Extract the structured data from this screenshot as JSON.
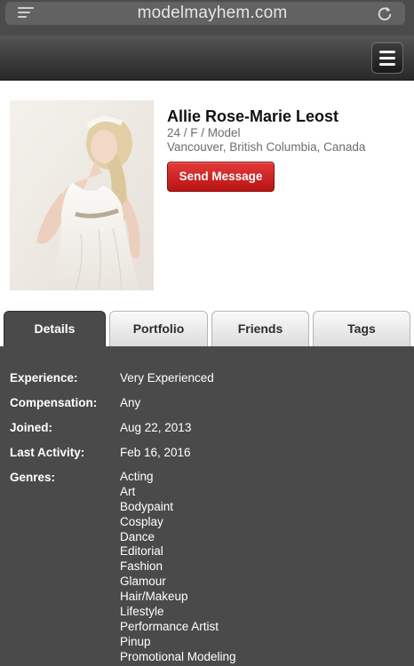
{
  "browser": {
    "url": "modelmayhem.com"
  },
  "profile": {
    "name": "Allie Rose-Marie Leost",
    "age_gender_role": "24 / F / Model",
    "location": "Vancouver, British Columbia, Canada",
    "send_message_label": "Send Message"
  },
  "tabs": [
    {
      "label": "Details",
      "active": true
    },
    {
      "label": "Portfolio",
      "active": false
    },
    {
      "label": "Friends",
      "active": false
    },
    {
      "label": "Tags",
      "active": false
    }
  ],
  "details": {
    "experience": {
      "label": "Experience:",
      "value": "Very Experienced"
    },
    "compensation": {
      "label": "Compensation:",
      "value": "Any"
    },
    "joined": {
      "label": "Joined:",
      "value": "Aug 22, 2013"
    },
    "last_activity": {
      "label": "Last Activity:",
      "value": "Feb 16, 2016"
    },
    "genres_label": "Genres:",
    "genres": [
      "Acting",
      "Art",
      "Bodypaint",
      "Cosplay",
      "Dance",
      "Editorial",
      "Fashion",
      "Glamour",
      "Hair/Makeup",
      "Lifestyle",
      "Performance Artist",
      "Pinup",
      "Promotional Modeling"
    ]
  },
  "colors": {
    "accent_red": "#c8201f",
    "header_dark": "#2a2a2a",
    "panel_gray": "#4a4a4a"
  }
}
